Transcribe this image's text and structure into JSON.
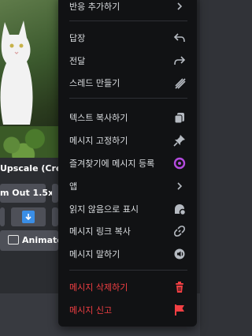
{
  "background": {
    "upscale_label": "Upscale (Creati",
    "zoom_label": "m Out 1.5x",
    "animate_label": "Animate ("
  },
  "menu": {
    "items": [
      {
        "label": "반응 추가하기",
        "icon": "chevron-right-icon"
      },
      {
        "label": "답장",
        "icon": "reply-icon"
      },
      {
        "label": "전달",
        "icon": "forward-icon"
      },
      {
        "label": "스레드 만들기",
        "icon": "thread-icon"
      },
      {
        "label": "텍스트 복사하기",
        "icon": "copy-icon"
      },
      {
        "label": "메시지 고정하기",
        "icon": "pin-icon"
      },
      {
        "label": "즐겨찾기에 메시지 등록",
        "icon": "bookmark-icon"
      },
      {
        "label": "앱",
        "icon": "chevron-right-icon"
      },
      {
        "label": "읽지 않음으로 표시",
        "icon": "unread-icon"
      },
      {
        "label": "메시지 링크 복사",
        "icon": "link-icon"
      },
      {
        "label": "메시지 말하기",
        "icon": "speaker-icon"
      },
      {
        "label": "메시지 삭제하기",
        "icon": "trash-icon"
      },
      {
        "label": "메시지 신고",
        "icon": "flag-icon"
      }
    ]
  },
  "colors": {
    "menu_bg": "#111214",
    "text": "#dbdee1",
    "danger": "#f23f43",
    "accent": "#b44bdf"
  }
}
